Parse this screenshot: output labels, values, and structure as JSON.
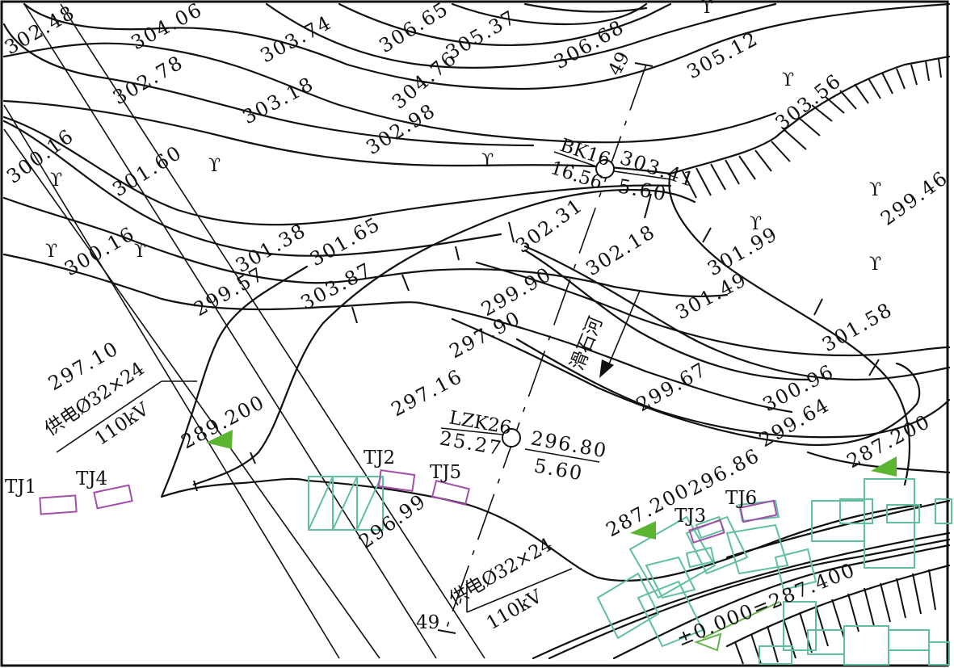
{
  "map": {
    "border_color": "#111111",
    "contour_color": "#111111",
    "building_color": "#5fbf9f",
    "foundation_box_color": "#a24fa8",
    "marker_color": "#5cb531",
    "datum_line_color": "#6ab04c"
  },
  "elevations": [
    "302.48",
    "304.06",
    "303.74",
    "306.65",
    "305.37",
    "306.68",
    "305.12",
    "302.78",
    "303.18",
    "304.76",
    "302.98",
    "303.56",
    "300.16",
    "301.60",
    "303.41",
    "299.46",
    "300.16",
    "301.38",
    "301.65",
    "302.31",
    "302.18",
    "299.57",
    "303.87",
    "299.90",
    "301.99",
    "301.49",
    "297.90",
    "301.58",
    "297.10",
    "297.16",
    "299.67",
    "300.96",
    "299.64",
    "296.86",
    "296.99",
    "296.80",
    "5.60"
  ],
  "boreholes": {
    "bk16": {
      "name": "BK16",
      "depth": "16.56",
      "elevation": "303.41",
      "water": "5.60"
    },
    "lzk26": {
      "name": "LZK26",
      "depth": "25.27"
    }
  },
  "power_lines": [
    {
      "label": "供电Ø32×24",
      "voltage": "110kV"
    },
    {
      "label": "供电Ø32×24",
      "voltage": "110kV"
    }
  ],
  "section_marks": {
    "top": "49",
    "bottom": "49"
  },
  "stream_label": "滑石河",
  "design_markers": [
    "289.200",
    "287.200",
    "287.200"
  ],
  "datum": "±0.000=287.400",
  "foundations": [
    "TJ1",
    "TJ4",
    "TJ2",
    "TJ5",
    "TJ3",
    "TJ6"
  ]
}
